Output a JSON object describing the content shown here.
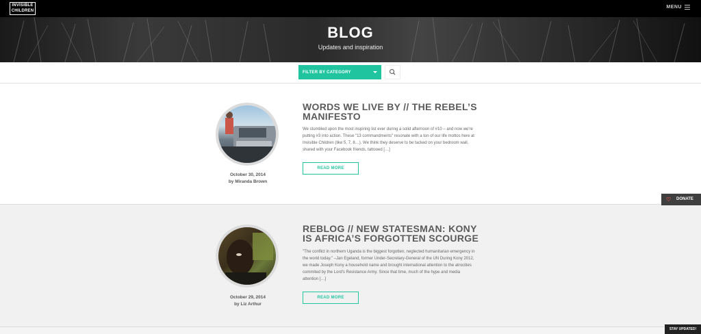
{
  "brand": {
    "logo_line1": "INVISIBLE",
    "logo_line2": "CHILDREN"
  },
  "nav": {
    "menu_label": "MENU"
  },
  "hero": {
    "title": "BLOG",
    "subtitle": "Updates and inspiration"
  },
  "filter": {
    "label": "FILTER BY CATEGORY"
  },
  "posts": [
    {
      "title": "WORDS WE LIVE BY // THE REBEL’S MANIFESTO",
      "excerpt": "We stumbled upon the most inspiring list ever during a solid afternoon of #10 – and now we're putting #3 into action. These \"13 commandments\" resonate with a ton of our life mottos here at Invisible Children (like 5, 7, 8…). We think they deserve to be tacked on your bedroom wall, shared with your Facebook friends, tattooed […]",
      "date": "October 30, 2014",
      "author": "by Miranda Brown",
      "button": "READ MORE"
    },
    {
      "title": "REBLOG // NEW STATESMAN: KONY IS AFRICA’S FORGOTTEN SCOURGE",
      "excerpt": "\"The conflict in northern Uganda is the biggest forgotten, neglected humanitarian emergency in the world today.\"    –Jan Egeland, former Under-Secretary-General of the UN During Kony 2012, we made Joseph Kony a household name and brought international attention to the atrocities commited by the Lord's Resistance Army. Since that time, much of the hype and media attention […]",
      "date": "October 29, 2014",
      "author": "by Liz Arthur",
      "button": "READ MORE"
    }
  ],
  "sidebar": {
    "donate_label": "DONATE"
  },
  "footer": {
    "stay_updated_label": "STAY UPDATED!"
  },
  "colors": {
    "accent": "#20c5a0",
    "topbar": "#000000",
    "donate_bg": "#3f3f3f"
  },
  "icons": [
    "hamburger-icon",
    "search-icon",
    "heart-icon",
    "chevron-down-icon"
  ]
}
